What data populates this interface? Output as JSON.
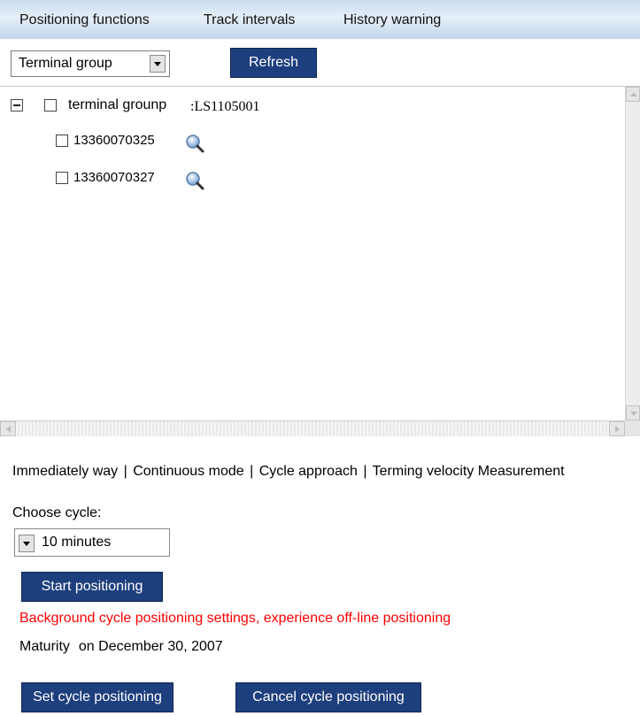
{
  "tabs": [
    "Positioning functions",
    "Track intervals",
    "History warning"
  ],
  "controls": {
    "group_select_value": "Terminal group",
    "refresh_label": "Refresh"
  },
  "tree": {
    "root_label": "terminal grounp",
    "root_code": ":LS1105001",
    "children": [
      "13360070325",
      "13360070327"
    ]
  },
  "modes": [
    "Immediately way",
    "Continuous mode",
    "Cycle approach",
    "Terming velocity Measurement"
  ],
  "modes_separator": "|",
  "cycle": {
    "label": "Choose cycle:",
    "value": "10 minutes"
  },
  "start_label": "Start positioning",
  "warning_text": "Background cycle positioning settings, experience off-line positioning",
  "maturity": {
    "label": "Maturity",
    "date": "on December 30, 2007"
  },
  "buttons": {
    "set_cycle": "Set cycle positioning",
    "cancel_cycle": "Cancel cycle positioning"
  },
  "colors": {
    "button_bg": "#1e3f7d",
    "warning": "#ff0000",
    "topbar": "#c9dcf0"
  },
  "icons": [
    "collapse-icon",
    "checkbox-icon",
    "magnifier-icon",
    "dropdown-arrow-icon",
    "scroll-arrow-icon"
  ]
}
